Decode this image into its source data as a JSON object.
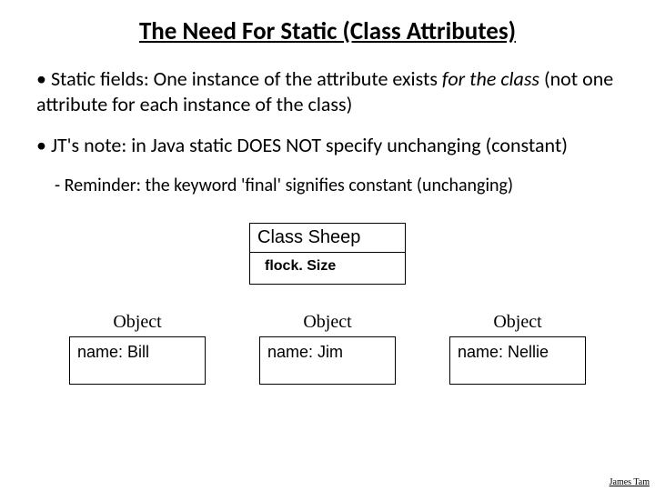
{
  "title": "The Need For Static (Class Attributes)",
  "bullet1_a": "Static fields: One instance of the attribute exists ",
  "bullet1_b": "for the class",
  "bullet1_c": " (not one attribute for each instance of the class)",
  "bullet2": "JT's note: in Java static DOES NOT specify unchanging (constant)",
  "sub1": " Reminder: the keyword 'final' signifies constant (unchanging)",
  "class_box": {
    "name": "Class Sheep",
    "attr": "flock. Size"
  },
  "objects": [
    {
      "label": "Object",
      "value": "name: Bill"
    },
    {
      "label": "Object",
      "value": "name: Jim"
    },
    {
      "label": "Object",
      "value": "name: Nellie"
    }
  ],
  "footer": "James Tam"
}
